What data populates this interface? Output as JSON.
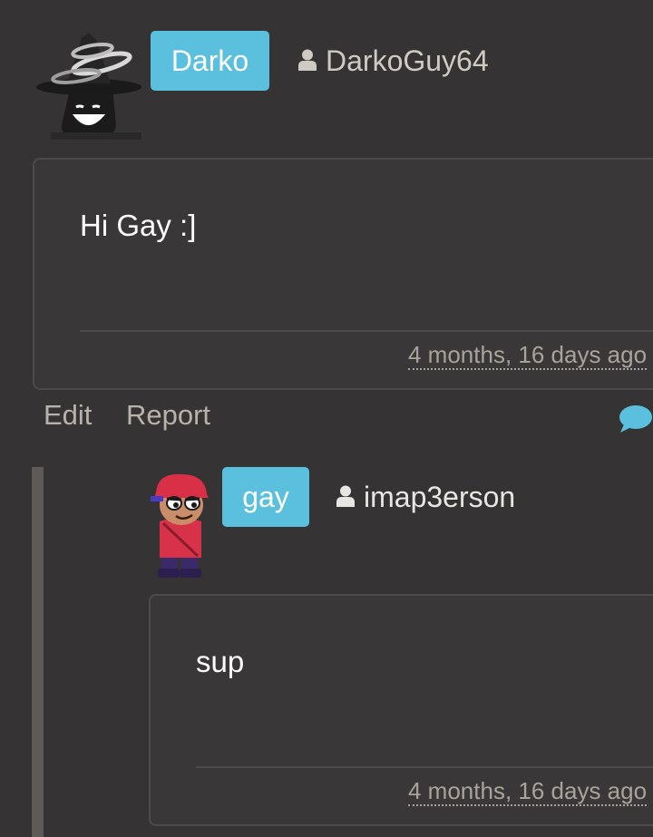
{
  "comments": [
    {
      "display_name": "Darko",
      "username": "DarkoGuy64",
      "text": "Hi Gay :]",
      "timestamp": "4 months, 16 days ago",
      "actions": {
        "edit": "Edit",
        "report": "Report"
      },
      "avatar": "witch-hat-shadow-avatar"
    },
    {
      "display_name": "gay",
      "username": "imap3erson",
      "text": "sup",
      "timestamp": "4 months, 16 days ago",
      "avatar": "red-cap-character-avatar"
    }
  ],
  "colors": {
    "background": "#363334",
    "badge": "#5bc0de",
    "reply_icon": "#5bc0de",
    "post_border": "#4d4a4b",
    "thread_line": "#5e5a57"
  },
  "icons": {
    "user": "user-silhouette-icon",
    "reply": "speech-bubble-icon"
  }
}
